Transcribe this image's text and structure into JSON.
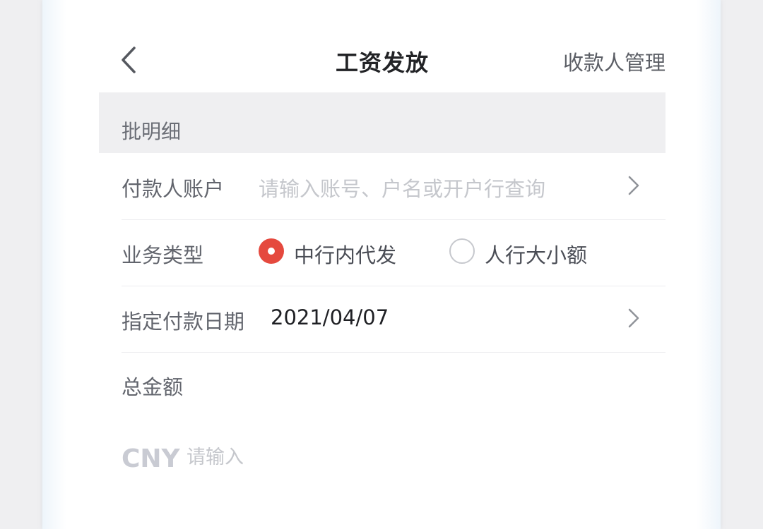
{
  "nav": {
    "title": "工资发放",
    "action_label": "收款人管理",
    "back_icon": "chevron-left-icon"
  },
  "section": {
    "title": "批明细"
  },
  "payer_account": {
    "label": "付款人账户",
    "placeholder": "请输入账号、户名或开户行查询"
  },
  "business_type": {
    "label": "业务类型",
    "options": [
      {
        "label": "中行内代发",
        "selected": true
      },
      {
        "label": "人行大小额",
        "selected": false
      }
    ]
  },
  "payment_date": {
    "label": "指定付款日期",
    "value": "2021/04/07"
  },
  "total_amount": {
    "label": "总金额",
    "currency": "CNY",
    "placeholder": "请输入"
  },
  "colors": {
    "accent": "#e5493e",
    "placeholder": "#c5c7cc",
    "section_bg": "#efeff1"
  }
}
